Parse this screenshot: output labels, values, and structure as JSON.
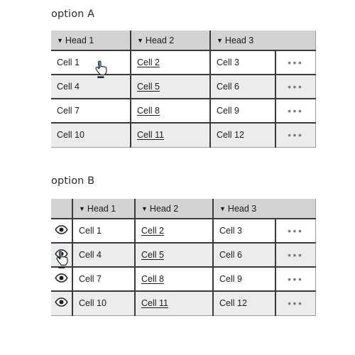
{
  "page": {
    "background": "#ffffff",
    "text_color": "#1b1b1b",
    "header_bg": "#d3d3d3",
    "alt_row_bg": "#ececec",
    "border_color": "#3a3a3a",
    "dots_color": "#7d7d7d"
  },
  "sections": [
    {
      "label": "option A",
      "table": {
        "headers": [
          {
            "sort_icon": "▼",
            "label": "Head 1"
          },
          {
            "sort_icon": "▼",
            "label": "Head 2"
          },
          {
            "sort_icon": "▼",
            "label": "Head 3"
          }
        ],
        "rows": [
          {
            "eye_icon": "eye-icon",
            "cells": [
              "Cell 1",
              "Cell 2",
              "Cell 3"
            ],
            "overflow": "•••"
          },
          {
            "eye_icon": "eye-icon",
            "cells": [
              "Cell 4",
              "Cell 5",
              "Cell 6"
            ],
            "overflow": "•••"
          },
          {
            "eye_icon": "eye-icon",
            "cells": [
              "Cell 7",
              "Cell 8",
              "Cell 9"
            ],
            "overflow": "•••"
          },
          {
            "eye_icon": "eye-icon",
            "cells": [
              "Cell 10",
              "Cell 11 ",
              "Cell 12"
            ],
            "overflow": "•••"
          }
        ]
      }
    },
    {
      "label": "option B",
      "table": {
        "headers": [
          {
            "sort_icon": "▼",
            "label": "Head 1"
          },
          {
            "sort_icon": "▼",
            "label": "Head 2"
          },
          {
            "sort_icon": "▼",
            "label": "Head 3"
          }
        ],
        "rows": [
          {
            "eye_icon": "eye-icon",
            "cells": [
              "Cell 1",
              "Cell 2",
              "Cell 3"
            ],
            "overflow": "•••"
          },
          {
            "eye_icon": "eye-icon",
            "cells": [
              "Cell 4",
              "Cell 5",
              "Cell 6"
            ],
            "overflow": "•••"
          },
          {
            "eye_icon": "eye-icon",
            "cells": [
              "Cell 7",
              "Cell 8",
              "Cell 9"
            ],
            "overflow": "•••"
          },
          {
            "eye_icon": "eye-icon",
            "cells": [
              "Cell 10",
              "Cell 11 ",
              "Cell 12"
            ],
            "overflow": "•••"
          }
        ]
      }
    }
  ],
  "cursors": [
    {
      "name": "pointing-hand-cursor",
      "section": "option A",
      "target_row": 1
    },
    {
      "name": "pointing-hand-cursor",
      "section": "option B",
      "target_row": 2
    }
  ]
}
